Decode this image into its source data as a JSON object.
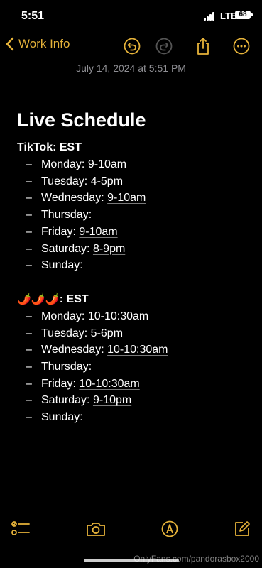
{
  "status": {
    "time": "5:51",
    "network": "LTE",
    "battery": "68"
  },
  "nav": {
    "back_label": "Work Info"
  },
  "note": {
    "date": "July 14, 2024 at 5:51 PM",
    "title": "Live Schedule",
    "sections": [
      {
        "heading": "TikTok: EST",
        "rows": [
          {
            "day": "Monday:",
            "time": "9-10am"
          },
          {
            "day": "Tuesday:",
            "time": "4-5pm"
          },
          {
            "day": "Wednesday:",
            "time": "9-10am"
          },
          {
            "day": "Thursday:",
            "time": ""
          },
          {
            "day": "Friday:",
            "time": "9-10am"
          },
          {
            "day": "Saturday:",
            "time": "8-9pm"
          },
          {
            "day": "Sunday:",
            "time": ""
          }
        ]
      },
      {
        "heading_emoji": "🌶️🌶️🌶️",
        "heading": ": EST",
        "rows": [
          {
            "day": "Monday:",
            "time": "10-10:30am"
          },
          {
            "day": "Tuesday:",
            "time": "5-6pm"
          },
          {
            "day": "Wednesday:",
            "time": "10-10:30am"
          },
          {
            "day": "Thursday:",
            "time": ""
          },
          {
            "day": "Friday:",
            "time": "10-10:30am"
          },
          {
            "day": "Saturday:",
            "time": "9-10pm"
          },
          {
            "day": "Sunday:",
            "time": ""
          }
        ]
      }
    ]
  },
  "watermark": "OnlyFans.com/pandorasbox2000",
  "colors": {
    "accent": "#e6b33a",
    "background": "#000000",
    "text": "#ffffff",
    "muted": "#8e8e93"
  },
  "icons": [
    "chevron-left-icon",
    "undo-icon",
    "redo-icon",
    "share-icon",
    "more-icon",
    "checklist-icon",
    "camera-icon",
    "markup-pen-icon",
    "compose-icon"
  ]
}
